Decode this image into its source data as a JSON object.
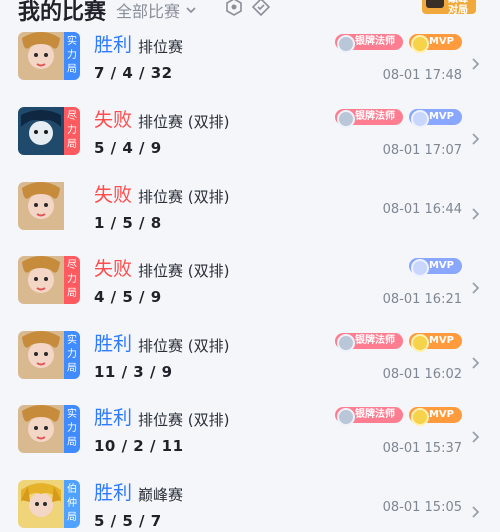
{
  "header": {
    "title": "我的比赛",
    "filter_label": "全部比赛",
    "badge_text": "巅峰\n对局"
  },
  "matches": [
    {
      "result": "胜利",
      "mode": "排位赛",
      "kda": "7 / 4 / 32",
      "time": "08-01 17:48",
      "tag": "实\n力\n局",
      "tag_color": "blue",
      "badges": [
        "银牌法师",
        "MVP"
      ],
      "mvp_color": "gold"
    },
    {
      "result": "失败",
      "mode": "排位赛 (双排)",
      "kda": "5 / 4 / 9",
      "time": "08-01 17:07",
      "tag": "尽\n力\n局",
      "tag_color": "red",
      "badges": [
        "银牌法师",
        "MVP"
      ],
      "mvp_color": "blue"
    },
    {
      "result": "失败",
      "mode": "排位赛 (双排)",
      "kda": "1 / 5 / 8",
      "time": "08-01 16:44",
      "tag": "",
      "tag_color": "",
      "badges": [],
      "mvp_color": ""
    },
    {
      "result": "失败",
      "mode": "排位赛 (双排)",
      "kda": "4 / 5 / 9",
      "time": "08-01 16:21",
      "tag": "尽\n力\n局",
      "tag_color": "red",
      "badges": [
        "MVP"
      ],
      "mvp_color": "blue"
    },
    {
      "result": "胜利",
      "mode": "排位赛 (双排)",
      "kda": "11 / 3 / 9",
      "time": "08-01 16:02",
      "tag": "实\n力\n局",
      "tag_color": "blue",
      "badges": [
        "银牌法师",
        "MVP"
      ],
      "mvp_color": "gold"
    },
    {
      "result": "胜利",
      "mode": "排位赛 (双排)",
      "kda": "10 / 2 / 11",
      "time": "08-01 15:37",
      "tag": "实\n力\n局",
      "tag_color": "blue",
      "badges": [
        "银牌法师",
        "MVP"
      ],
      "mvp_color": "gold"
    },
    {
      "result": "胜利",
      "mode": "巅峰赛",
      "kda": "5 / 5 / 7",
      "time": "08-01 15:05",
      "tag": "伯\n仲\n局",
      "tag_color": "lightblue",
      "badges": [],
      "mvp_color": ""
    }
  ],
  "colors": {
    "win": "#2f7bff",
    "lose": "#ff4c4c"
  }
}
